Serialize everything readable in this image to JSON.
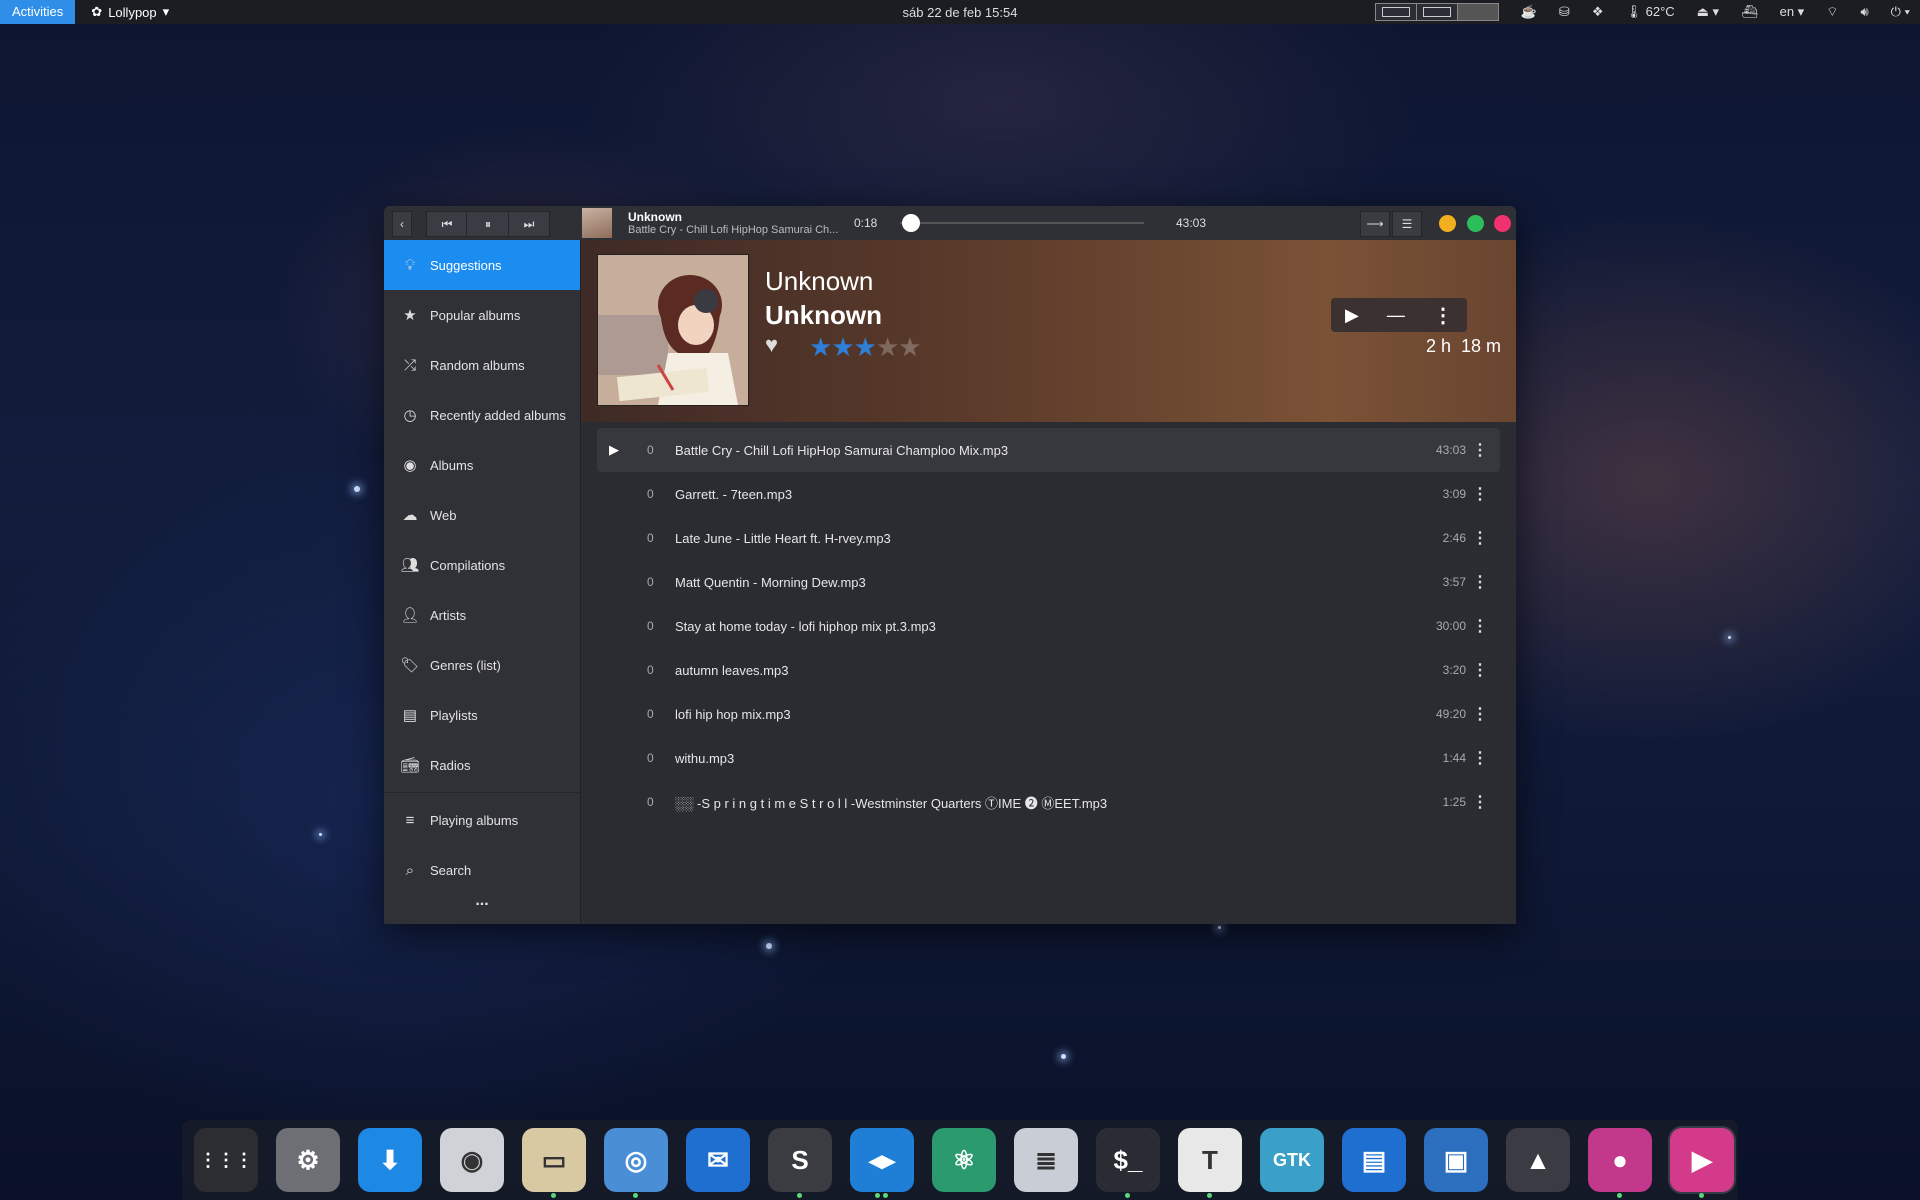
{
  "topbar": {
    "activities": "Activities",
    "app_name": "Lollypop",
    "clock": "sáb 22 de feb  15:54",
    "temperature": "62°C",
    "language": "en"
  },
  "player": {
    "artist": "Unknown",
    "track": "Battle Cry - Chill Lofi HipHop Samurai Ch...",
    "elapsed": "0:18",
    "total": "43:03",
    "progress_fraction": 0.007
  },
  "sidebar": {
    "items": [
      {
        "label": "Suggestions",
        "icon": "lightbulb-icon"
      },
      {
        "label": "Popular albums",
        "icon": "star-icon"
      },
      {
        "label": "Random albums",
        "icon": "shuffle-icon"
      },
      {
        "label": "Recently added albums",
        "icon": "history-icon"
      },
      {
        "label": "Albums",
        "icon": "disc-icon"
      },
      {
        "label": "Web",
        "icon": "cloud-icon"
      },
      {
        "label": "Compilations",
        "icon": "group-icon"
      },
      {
        "label": "Artists",
        "icon": "person-icon"
      },
      {
        "label": "Genres (list)",
        "icon": "tag-icon"
      },
      {
        "label": "Playlists",
        "icon": "playlist-icon"
      },
      {
        "label": "Radios",
        "icon": "radio-icon"
      },
      {
        "label": "Playing albums",
        "icon": "queue-icon"
      },
      {
        "label": "Search",
        "icon": "search-icon"
      }
    ],
    "more": "..."
  },
  "album": {
    "artist": "Unknown",
    "title": "Unknown",
    "rating": 3,
    "rating_max": 5,
    "duration": "2 h  18 m"
  },
  "tracks": [
    {
      "num": "0",
      "title": "Battle Cry - Chill Lofi HipHop Samurai Champloo Mix.mp3",
      "duration": "43:03",
      "playing": true
    },
    {
      "num": "0",
      "title": "Garrett. - 7teen.mp3",
      "duration": "3:09"
    },
    {
      "num": "0",
      "title": "Late June - Little Heart ft. H-rvey.mp3",
      "duration": "2:46"
    },
    {
      "num": "0",
      "title": "Matt Quentin - Morning Dew.mp3",
      "duration": "3:57"
    },
    {
      "num": "0",
      "title": "Stay at home today - lofi hiphop mix pt.3.mp3",
      "duration": "30:00"
    },
    {
      "num": "0",
      "title": "autumn leaves.mp3",
      "duration": "3:20"
    },
    {
      "num": "0",
      "title": "lofi hip hop mix.mp3",
      "duration": "49:20"
    },
    {
      "num": "0",
      "title": "withu.mp3",
      "duration": "1:44"
    },
    {
      "num": "0",
      "title": "░░ -S p r i n g t i m e S t r o l l -Westminster Quarters ⓉIME ❷ ⓂEET.mp3",
      "duration": "1:25"
    }
  ],
  "dock": {
    "apps": [
      {
        "name": "app-grid",
        "glyph": "⋮⋮⋮",
        "color": "#2b2d33"
      },
      {
        "name": "settings",
        "glyph": "⚙",
        "color": "#6d6f75"
      },
      {
        "name": "downloader",
        "glyph": "⬇",
        "color": "#1e88e5"
      },
      {
        "name": "tweaks",
        "glyph": "◉",
        "color": "#cfd3d8"
      },
      {
        "name": "files",
        "glyph": "▭",
        "color": "#d9c9a3"
      },
      {
        "name": "chromium",
        "glyph": "◎",
        "color": "#4a8fd6"
      },
      {
        "name": "thunderbird",
        "glyph": "✉",
        "color": "#1f6fd1"
      },
      {
        "name": "simplenote",
        "glyph": "S",
        "color": "#3a3c42"
      },
      {
        "name": "vscode",
        "glyph": "◂▸",
        "color": "#1f7fd6"
      },
      {
        "name": "atom",
        "glyph": "⚛",
        "color": "#2b9a6e"
      },
      {
        "name": "text-editor",
        "glyph": "≣",
        "color": "#c9ced6"
      },
      {
        "name": "terminal",
        "glyph": "$_",
        "color": "#2a2c33"
      },
      {
        "name": "typora",
        "glyph": "T",
        "color": "#e8e8e8"
      },
      {
        "name": "gtk-inspector",
        "glyph": "GTK",
        "color": "#3aa0c8"
      },
      {
        "name": "disks",
        "glyph": "▤",
        "color": "#1f6fd1"
      },
      {
        "name": "image-viewer",
        "glyph": "▣",
        "color": "#2d6fbf"
      },
      {
        "name": "inkscape",
        "glyph": "▲",
        "color": "#3b3b44"
      },
      {
        "name": "gradience",
        "glyph": "●",
        "color": "#c2388a"
      },
      {
        "name": "lollypop",
        "glyph": "▶",
        "color": "#d43a8a"
      }
    ]
  }
}
